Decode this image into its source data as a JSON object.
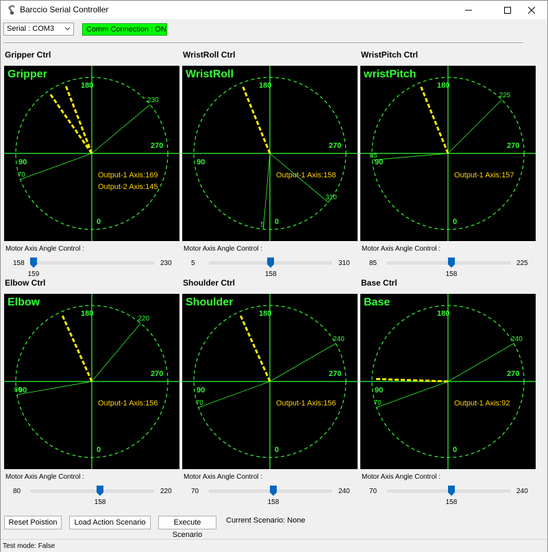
{
  "window": {
    "title": "Barccio Serial Controller",
    "icon": "robot-arm-icon",
    "controls": [
      "minimize-icon",
      "maximize-icon",
      "close-icon"
    ]
  },
  "toolbar": {
    "serial_value": "Serial : COM3",
    "comm_status": "Comm Connection : ON",
    "comm_color": "#00ff00"
  },
  "colors": {
    "scope_bg": "#000000",
    "grid": "#33ff33",
    "pointer": "#ffee00",
    "output_text": "#ffd400"
  },
  "panels": [
    {
      "title": "Gripper Ctrl",
      "scope_name": "Gripper",
      "labels": {
        "top": "180",
        "left": "90",
        "right": "270",
        "bottom": "0"
      },
      "range_min_angle": 70,
      "range_max_angle": 230,
      "range_min_label": "70",
      "range_max_label": "230",
      "pointers": [
        159,
        145
      ],
      "outputs": [
        "Output-1 Axis:169",
        "Output-2 Axis:145"
      ],
      "motor_label": "Motor Axis Angle Control :",
      "slider": {
        "min": "158",
        "max": "230",
        "value": "159",
        "fraction": 0.02
      }
    },
    {
      "title": "WristRoll Ctrl",
      "scope_name": "WristRoll",
      "labels": {
        "top": "180",
        "left": "90",
        "right": "270",
        "bottom": "0"
      },
      "range_min_angle": 5,
      "range_max_angle": 310,
      "range_min_label": "5",
      "range_max_label": "310",
      "pointers": [
        158
      ],
      "outputs": [
        "Output-1 Axis:158"
      ],
      "motor_label": "Motor Axis Angle Control :",
      "slider": {
        "min": "5",
        "max": "310",
        "value": "158",
        "fraction": 0.5
      }
    },
    {
      "title": "WristPitch Ctrl",
      "scope_name": "wristPitch",
      "labels": {
        "top": "180",
        "left": "90",
        "right": "270",
        "bottom": "0"
      },
      "range_min_angle": 85,
      "range_max_angle": 225,
      "range_min_label": "85",
      "range_max_label": "225",
      "pointers": [
        158
      ],
      "outputs": [
        "Output-1 Axis:157"
      ],
      "motor_label": "Motor Axis Angle Control :",
      "slider": {
        "min": "85",
        "max": "225",
        "value": "158",
        "fraction": 0.52
      }
    },
    {
      "title": "Elbow Ctrl",
      "scope_name": "Elbow",
      "labels": {
        "top": "180",
        "left": "90",
        "right": "270",
        "bottom": "0"
      },
      "range_min_angle": 80,
      "range_max_angle": 220,
      "range_min_label": "80",
      "range_max_label": "220",
      "pointers": [
        156
      ],
      "outputs": [
        "Output-1 Axis:156"
      ],
      "motor_label": "Motor Axis Angle Control :",
      "slider": {
        "min": "80",
        "max": "220",
        "value": "158",
        "fraction": 0.56
      }
    },
    {
      "title": "Shoulder Ctrl",
      "scope_name": "Shoulder",
      "labels": {
        "top": "180",
        "left": "90",
        "right": "270",
        "bottom": "0"
      },
      "range_min_angle": 70,
      "range_max_angle": 240,
      "range_min_label": "70",
      "range_max_label": "240",
      "pointers": [
        156
      ],
      "outputs": [
        "Output-1 Axis:156"
      ],
      "motor_label": "Motor Axis Angle Control :",
      "slider": {
        "min": "70",
        "max": "240",
        "value": "158",
        "fraction": 0.52
      }
    },
    {
      "title": "Base Ctrl",
      "scope_name": "Base",
      "labels": {
        "top": "180",
        "left": "90",
        "right": "270",
        "bottom": "0"
      },
      "range_min_angle": 70,
      "range_max_angle": 240,
      "range_min_label": "70",
      "range_max_label": "240",
      "pointers": [
        92
      ],
      "outputs": [
        "Output-1 Axis:92"
      ],
      "motor_label": "Motor Axis Angle Control :",
      "slider": {
        "min": "70",
        "max": "240",
        "value": "158",
        "fraction": 0.52
      }
    }
  ],
  "buttons": {
    "reset": "Reset Poistion",
    "load": "Load Action Scenario",
    "execute": "Execute Scenario"
  },
  "scenario_status": "Current Scenario: None",
  "status_bar": "Test mode: False"
}
